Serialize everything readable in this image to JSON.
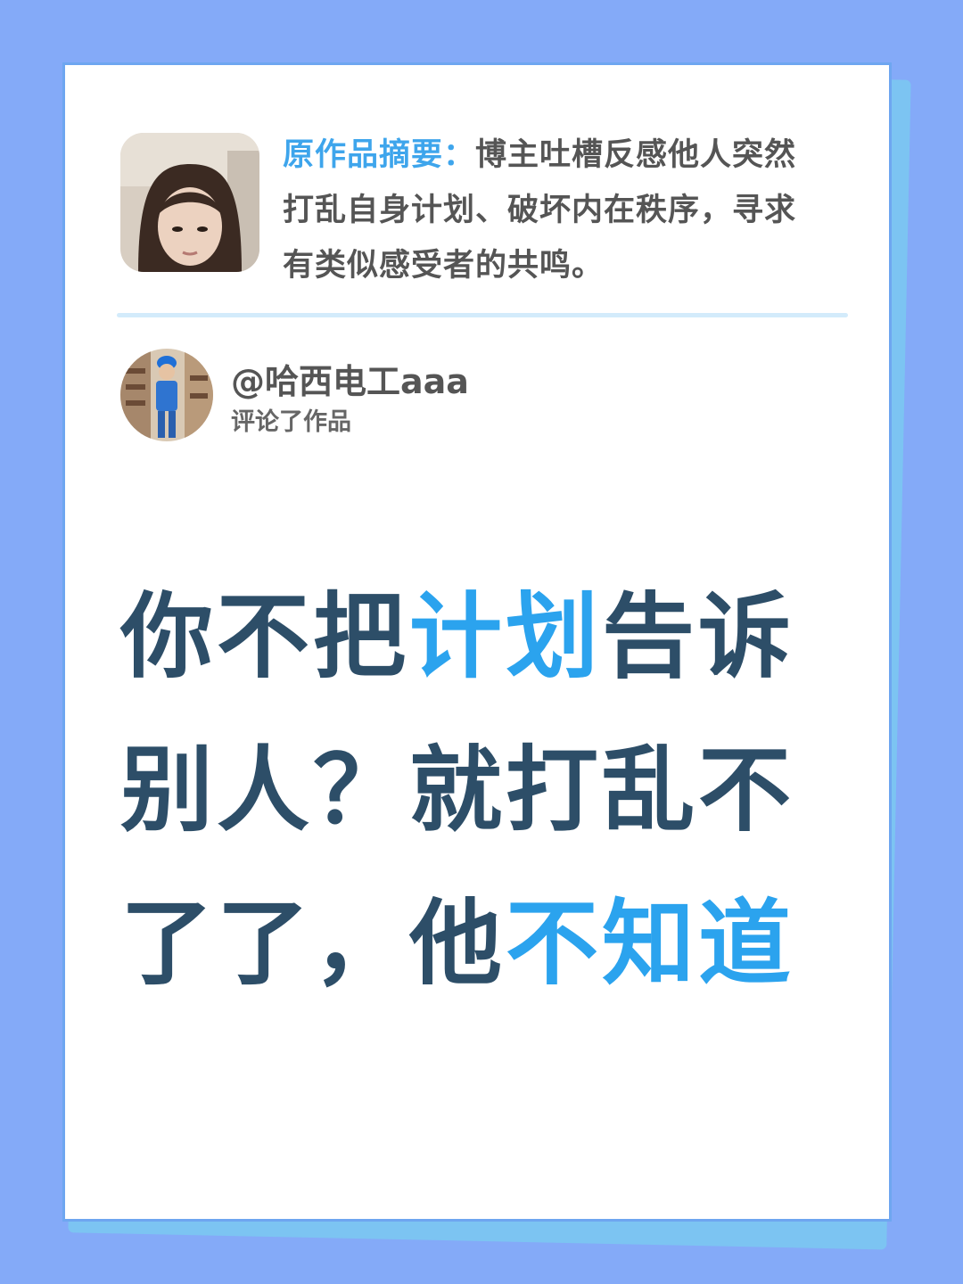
{
  "summary": {
    "label": "原作品摘要：",
    "text_line1": "博主吐槽反感他人突然",
    "text_line2": "打乱自身计划、破坏内在秩序，寻求",
    "text_line3": "有类似感受者的共鸣。"
  },
  "comment": {
    "handle": "@哈西电工aaa",
    "action": "评论了作品"
  },
  "headline": {
    "l1a": "你不把",
    "l1b": "计划",
    "l1c": "告诉",
    "l2": "别人？就打乱不",
    "l3a": "了了，他",
    "l3b": "不知道"
  },
  "colors": {
    "background": "#84aaf8",
    "accent": "#2ba3ee",
    "headline": "#2d4e68"
  },
  "icons": [
    "author-avatar",
    "commenter-avatar"
  ]
}
